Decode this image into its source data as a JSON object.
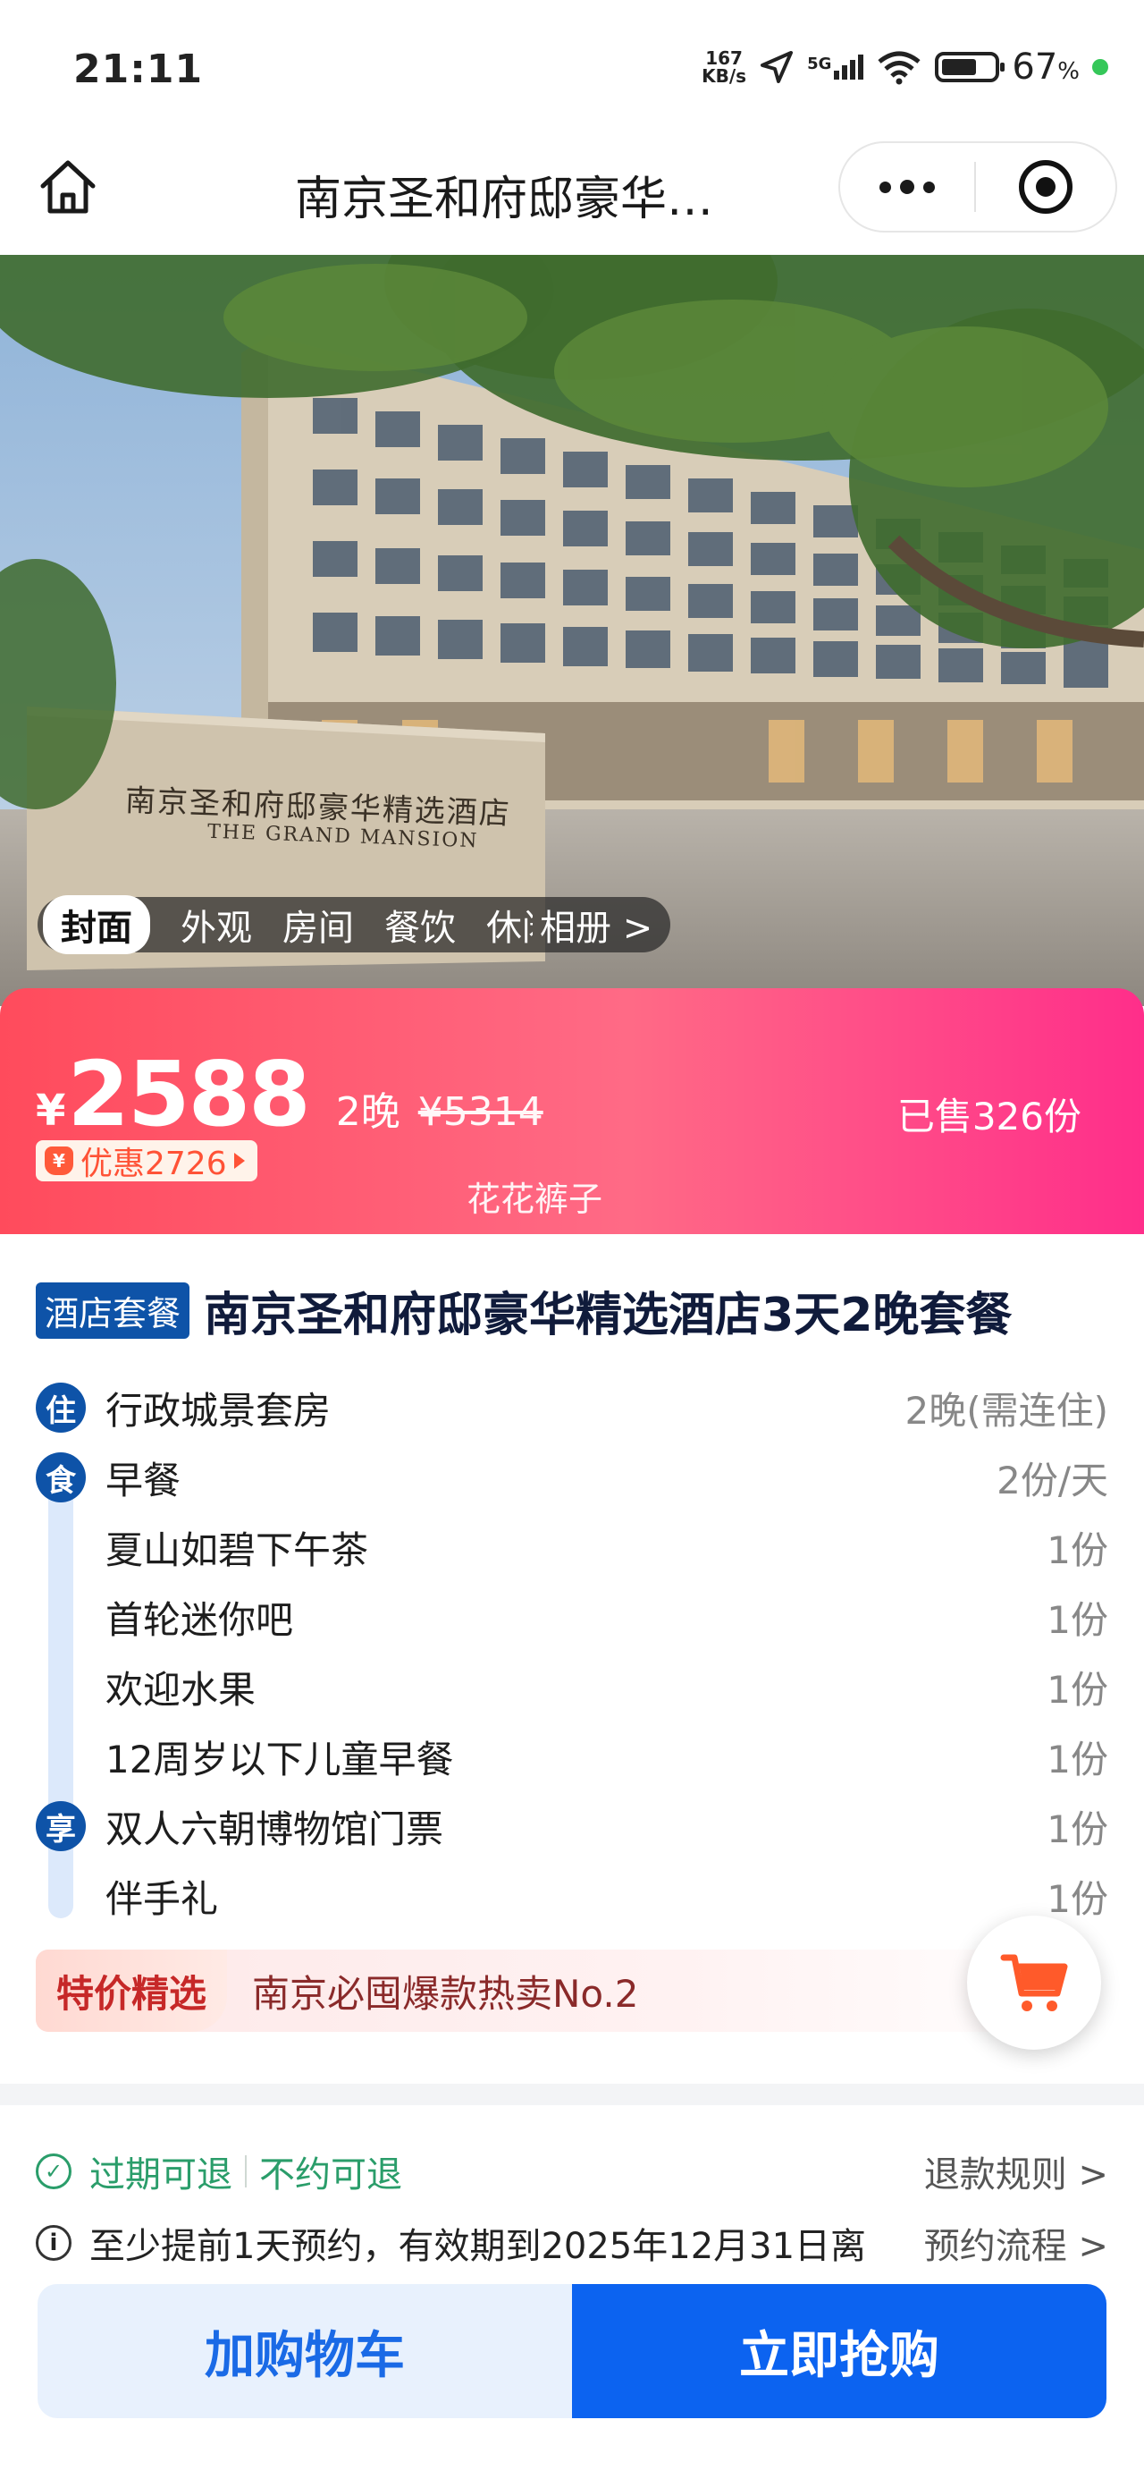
{
  "status_bar": {
    "time": "21:11",
    "net_speed_top": "167",
    "net_speed_bottom": "KB/s",
    "network": "5G",
    "battery": "67",
    "battery_unit": "%"
  },
  "nav": {
    "title": "南京圣和府邸豪华…",
    "icons": [
      "home-icon",
      "more-icon",
      "target-icon"
    ]
  },
  "hero": {
    "sign_cn": "南京圣和府邸豪华精选酒店",
    "sign_en": "THE GRAND MANSION",
    "tabs": [
      "封面",
      "外观",
      "房间",
      "餐饮",
      "休闲",
      "相册 >"
    ]
  },
  "price": {
    "currency": "¥",
    "amount": "2588",
    "nights": "2晚",
    "original": "¥5314",
    "discount": "优惠2726",
    "sold": "已售326份",
    "watermark": "花花裤子"
  },
  "product": {
    "badge": "酒店套餐",
    "title": "南京圣和府邸豪华精选酒店3天2晚套餐"
  },
  "items": [
    {
      "icon": "住",
      "label": "行政城景套房",
      "qty": "2晚(需连住)"
    },
    {
      "icon": "食",
      "label": "早餐",
      "qty": "2份/天"
    },
    {
      "icon": "",
      "label": "夏山如碧下午茶",
      "qty": "1份"
    },
    {
      "icon": "",
      "label": "首轮迷你吧",
      "qty": "1份"
    },
    {
      "icon": "",
      "label": "欢迎水果",
      "qty": "1份"
    },
    {
      "icon": "",
      "label": "12周岁以下儿童早餐",
      "qty": "1份"
    },
    {
      "icon": "享",
      "label": "双人六朝博物馆门票",
      "qty": "1份"
    },
    {
      "icon": "",
      "label": "伴手礼",
      "qty": "1份"
    }
  ],
  "special": {
    "tag": "特价精选",
    "text": "南京必囤爆款热卖No.2"
  },
  "refund": {
    "expired": "过期可退",
    "no_appt": "不约可退",
    "rules_link": "退款规则 >"
  },
  "booking": {
    "info": "至少提前1天预约，有效期到2025年12月31日离",
    "flow_link": "预约流程 >"
  },
  "actions": {
    "add_cart": "加购物车",
    "buy_now": "立即抢购"
  },
  "colors": {
    "brand_blue": "#0e53a8",
    "buy_blue": "#0c63f0",
    "price_pink": "#ff4b5c",
    "refund_green": "#2a9d6a"
  }
}
